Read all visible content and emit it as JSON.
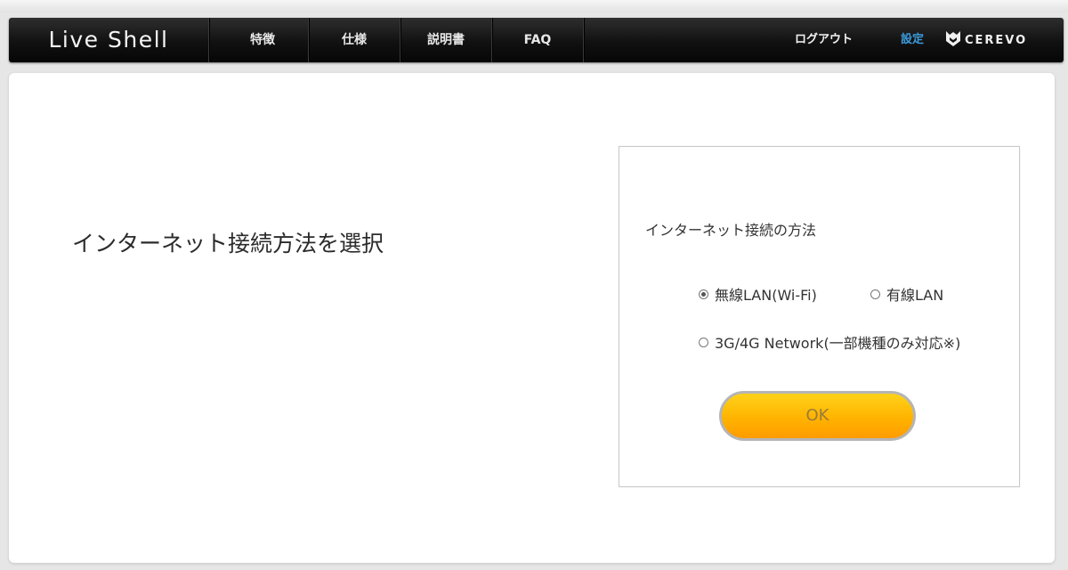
{
  "header": {
    "logo": "Live Shell",
    "nav": [
      "特徴",
      "仕様",
      "説明書",
      "FAQ"
    ],
    "logout": "ログアウト",
    "settings": "設定",
    "brand": "CEREVO",
    "settings_color": "#3a9ad9"
  },
  "main": {
    "heading": "インターネット接続方法を選択"
  },
  "form": {
    "title": "インターネット接続の方法",
    "options": [
      {
        "label": "無線LAN(Wi-Fi)",
        "checked": true
      },
      {
        "label": "有線LAN",
        "checked": false
      },
      {
        "label": "3G/4G Network(一部機種のみ対応※)",
        "checked": false
      }
    ],
    "ok_label": "OK",
    "button_color": "#ffb300"
  }
}
